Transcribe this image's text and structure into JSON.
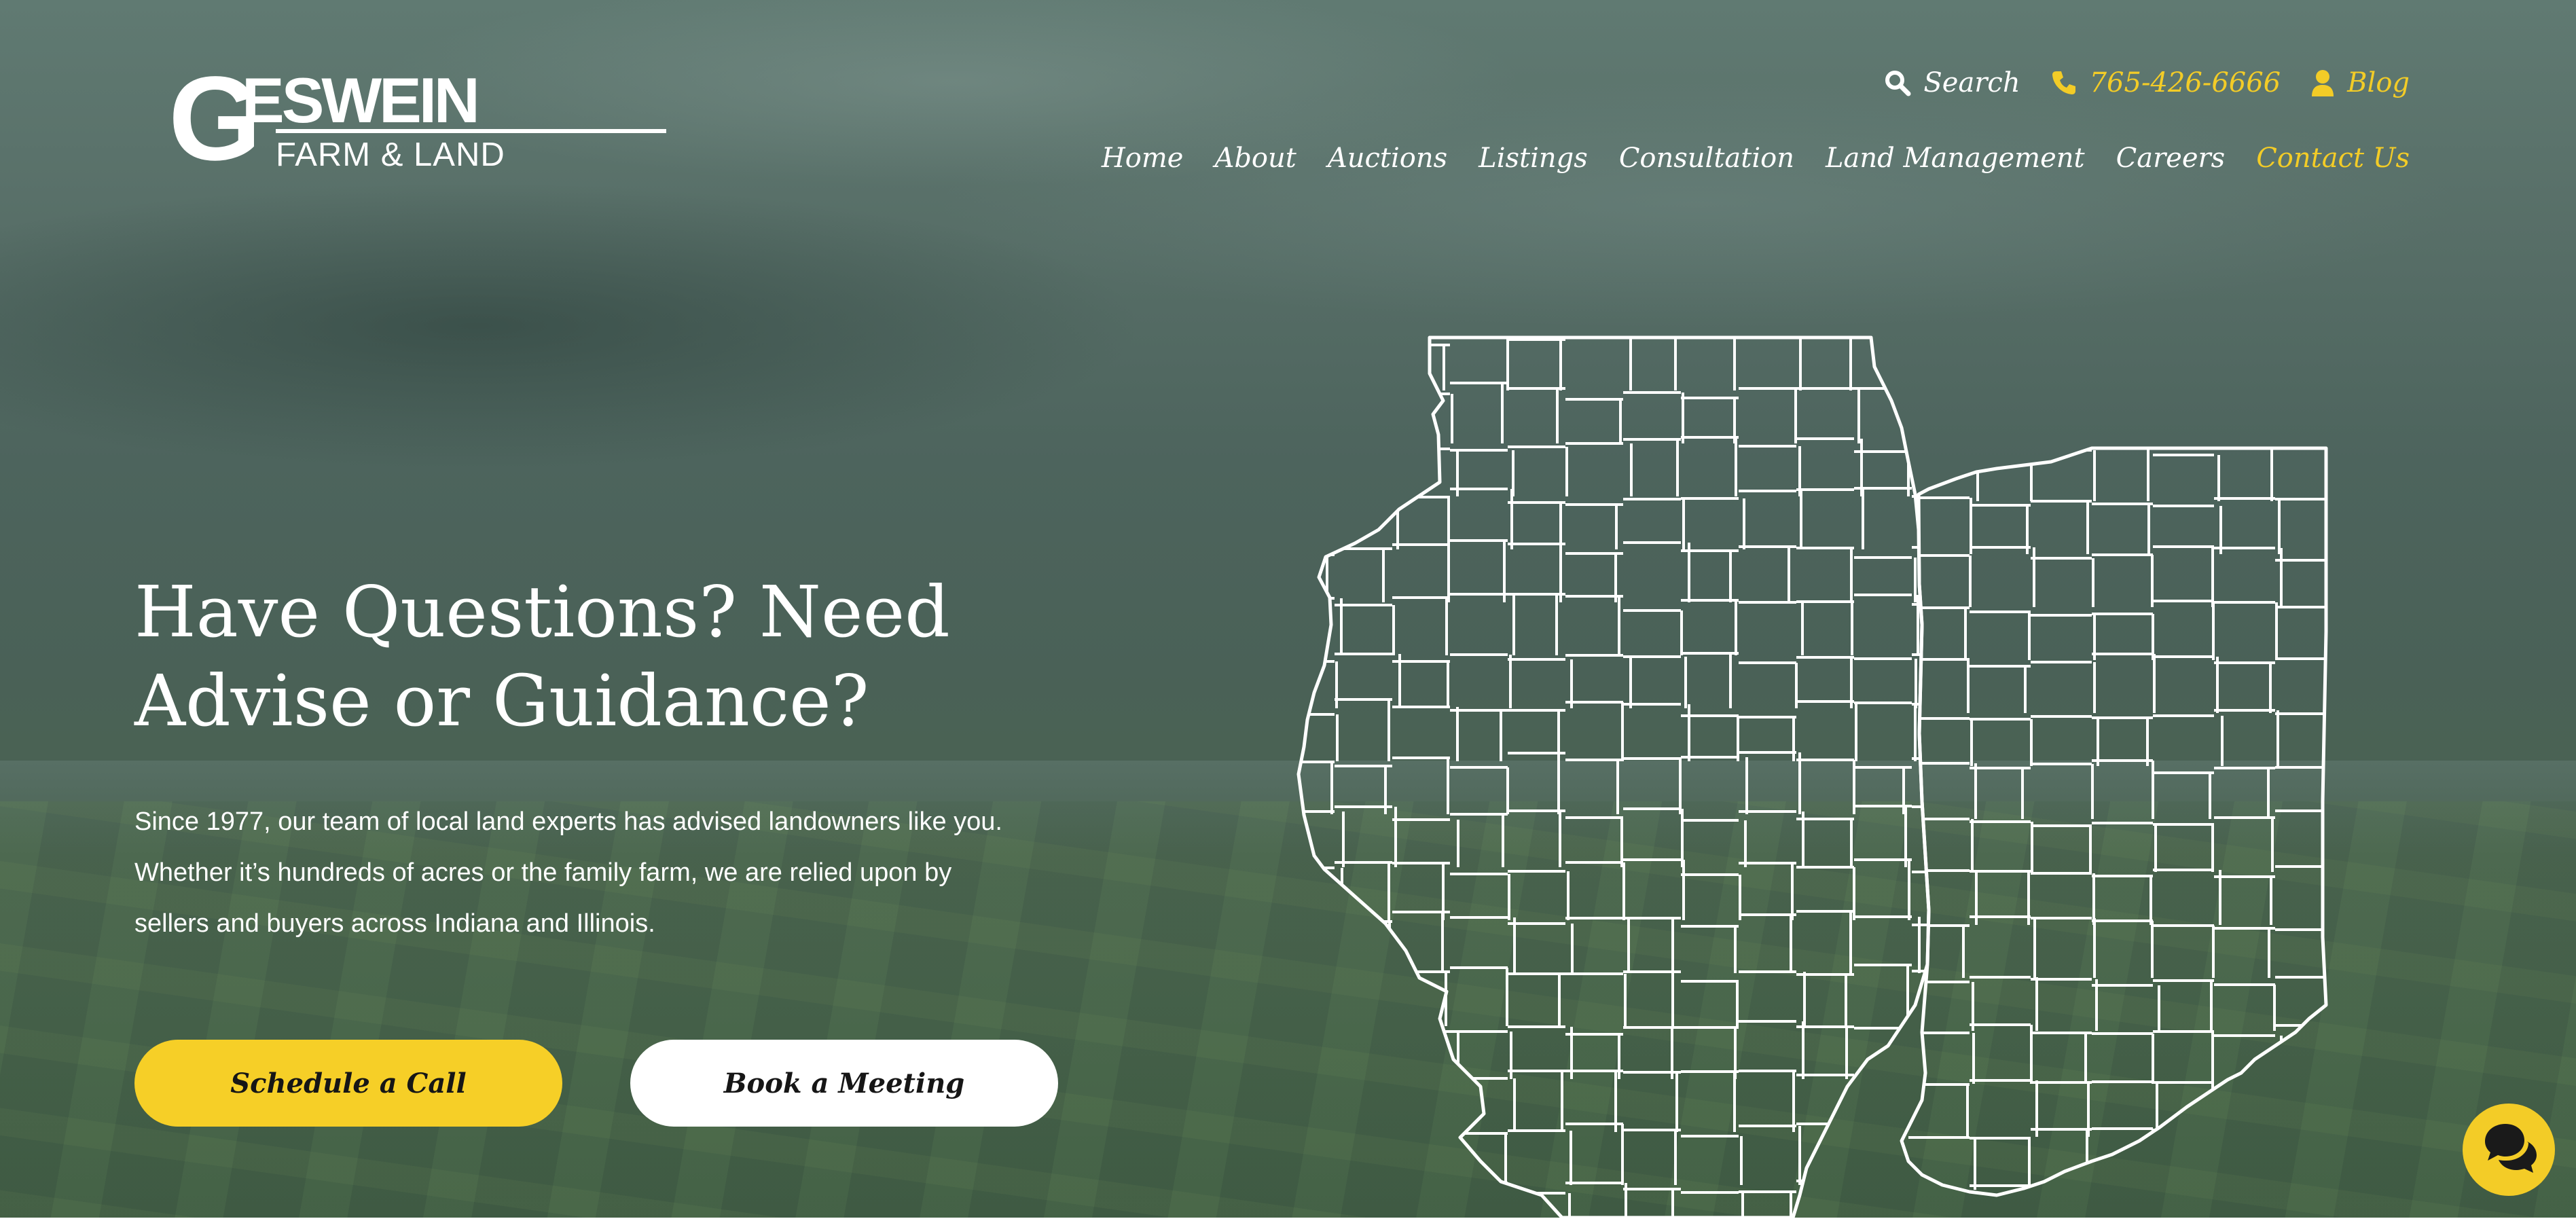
{
  "brand": {
    "logo_letter": "G",
    "logo_main": "ESWEIN",
    "logo_sub": "FARM & LAND",
    "accent_color": "#f3cc27"
  },
  "utility": {
    "search_label": "Search",
    "phone": "765-426-6666",
    "blog_label": "Blog"
  },
  "nav": {
    "items": [
      "Home",
      "About",
      "Auctions",
      "Listings",
      "Consultation",
      "Land Management",
      "Careers",
      "Contact Us"
    ],
    "active": "Contact Us"
  },
  "hero": {
    "headline_line1": "Have Questions? Need",
    "headline_line2": "Advise or Guidance?",
    "subtext_line1": "Since 1977, our team of local land experts has advised landowners like you.",
    "subtext_line2": "Whether it’s hundreds of acres or the family farm, we are relied upon by",
    "subtext_line3": "sellers and buyers across Indiana and Illinois.",
    "cta_primary": "Schedule a Call",
    "cta_secondary": "Book a Meeting"
  },
  "icons": {
    "search": "search-icon",
    "phone": "phone-icon",
    "user": "user-icon",
    "chat": "chat-icon",
    "map": "illinois-indiana-county-map"
  }
}
